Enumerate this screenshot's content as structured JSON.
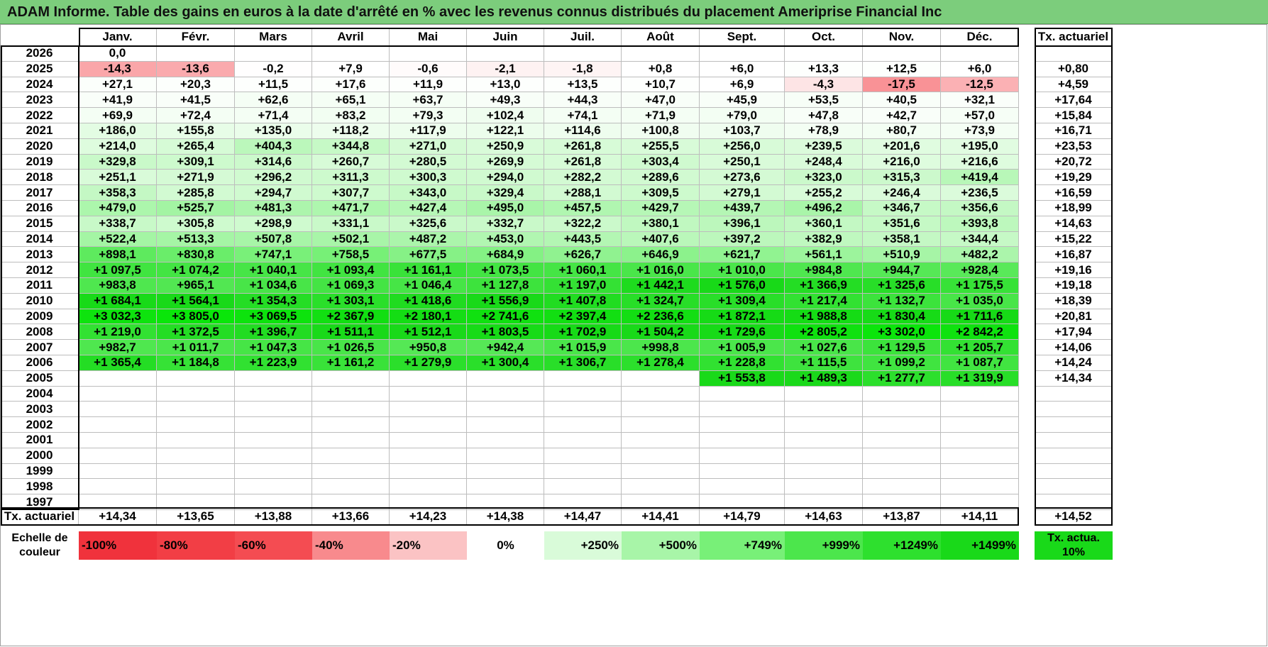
{
  "title": "ADAM Informe. Table des gains en euros à la date d'arrêté en % avec les revenus connus distribués du placement Ameriprise Financial Inc",
  "chart_data": {
    "type": "table",
    "months": [
      "Janv.",
      "Févr.",
      "Mars",
      "Avril",
      "Mai",
      "Juin",
      "Juil.",
      "Août",
      "Sept.",
      "Oct.",
      "Nov.",
      "Déc."
    ],
    "annual_header": "Tx. actuariel",
    "rows": [
      {
        "year": "2026",
        "values": [
          "0,0",
          "",
          "",
          "",
          "",
          "",
          "",
          "",
          "",
          "",
          "",
          ""
        ],
        "rate": ""
      },
      {
        "year": "2025",
        "values": [
          "-14,3",
          "-13,6",
          "-0,2",
          "+7,9",
          "-0,6",
          "-2,1",
          "-1,8",
          "+0,8",
          "+6,0",
          "+13,3",
          "+12,5",
          "+6,0"
        ],
        "rate": "+0,80"
      },
      {
        "year": "2024",
        "values": [
          "+27,1",
          "+20,3",
          "+11,5",
          "+17,6",
          "+11,9",
          "+13,0",
          "+13,5",
          "+10,7",
          "+6,9",
          "-4,3",
          "-17,5",
          "-12,5"
        ],
        "rate": "+4,59"
      },
      {
        "year": "2023",
        "values": [
          "+41,9",
          "+41,5",
          "+62,6",
          "+65,1",
          "+63,7",
          "+49,3",
          "+44,3",
          "+47,0",
          "+45,9",
          "+53,5",
          "+40,5",
          "+32,1"
        ],
        "rate": "+17,64"
      },
      {
        "year": "2022",
        "values": [
          "+69,9",
          "+72,4",
          "+71,4",
          "+83,2",
          "+79,3",
          "+102,4",
          "+74,1",
          "+71,9",
          "+79,0",
          "+47,8",
          "+42,7",
          "+57,0"
        ],
        "rate": "+15,84"
      },
      {
        "year": "2021",
        "values": [
          "+186,0",
          "+155,8",
          "+135,0",
          "+118,2",
          "+117,9",
          "+122,1",
          "+114,6",
          "+100,8",
          "+103,7",
          "+78,9",
          "+80,7",
          "+73,9"
        ],
        "rate": "+16,71"
      },
      {
        "year": "2020",
        "values": [
          "+214,0",
          "+265,4",
          "+404,3",
          "+344,8",
          "+271,0",
          "+250,9",
          "+261,8",
          "+255,5",
          "+256,0",
          "+239,5",
          "+201,6",
          "+195,0"
        ],
        "rate": "+23,53"
      },
      {
        "year": "2019",
        "values": [
          "+329,8",
          "+309,1",
          "+314,6",
          "+260,7",
          "+280,5",
          "+269,9",
          "+261,8",
          "+303,4",
          "+250,1",
          "+248,4",
          "+216,0",
          "+216,6"
        ],
        "rate": "+20,72"
      },
      {
        "year": "2018",
        "values": [
          "+251,1",
          "+271,9",
          "+296,2",
          "+311,3",
          "+300,3",
          "+294,0",
          "+282,2",
          "+289,6",
          "+273,6",
          "+323,0",
          "+315,3",
          "+419,4"
        ],
        "rate": "+19,29"
      },
      {
        "year": "2017",
        "values": [
          "+358,3",
          "+285,8",
          "+294,7",
          "+307,7",
          "+343,0",
          "+329,4",
          "+288,1",
          "+309,5",
          "+279,1",
          "+255,2",
          "+246,4",
          "+236,5"
        ],
        "rate": "+16,59"
      },
      {
        "year": "2016",
        "values": [
          "+479,0",
          "+525,7",
          "+481,3",
          "+471,7",
          "+427,4",
          "+495,0",
          "+457,5",
          "+429,7",
          "+439,7",
          "+496,2",
          "+346,7",
          "+356,6"
        ],
        "rate": "+18,99"
      },
      {
        "year": "2015",
        "values": [
          "+338,7",
          "+305,8",
          "+298,9",
          "+331,1",
          "+325,6",
          "+332,7",
          "+322,2",
          "+380,1",
          "+396,1",
          "+360,1",
          "+351,6",
          "+393,8"
        ],
        "rate": "+14,63"
      },
      {
        "year": "2014",
        "values": [
          "+522,4",
          "+513,3",
          "+507,8",
          "+502,1",
          "+487,2",
          "+453,0",
          "+443,5",
          "+407,6",
          "+397,2",
          "+382,9",
          "+358,1",
          "+344,4"
        ],
        "rate": "+15,22"
      },
      {
        "year": "2013",
        "values": [
          "+898,1",
          "+830,8",
          "+747,1",
          "+758,5",
          "+677,5",
          "+684,9",
          "+626,7",
          "+646,9",
          "+621,7",
          "+561,1",
          "+510,9",
          "+482,2"
        ],
        "rate": "+16,87"
      },
      {
        "year": "2012",
        "values": [
          "+1 097,5",
          "+1 074,2",
          "+1 040,1",
          "+1 093,4",
          "+1 161,1",
          "+1 073,5",
          "+1 060,1",
          "+1 016,0",
          "+1 010,0",
          "+984,8",
          "+944,7",
          "+928,4"
        ],
        "rate": "+19,16"
      },
      {
        "year": "2011",
        "values": [
          "+983,8",
          "+965,1",
          "+1 034,6",
          "+1 069,3",
          "+1 046,4",
          "+1 127,8",
          "+1 197,0",
          "+1 442,1",
          "+1 576,0",
          "+1 366,9",
          "+1 325,6",
          "+1 175,5"
        ],
        "rate": "+19,18"
      },
      {
        "year": "2010",
        "values": [
          "+1 684,1",
          "+1 564,1",
          "+1 354,3",
          "+1 303,1",
          "+1 418,6",
          "+1 556,9",
          "+1 407,8",
          "+1 324,7",
          "+1 309,4",
          "+1 217,4",
          "+1 132,7",
          "+1 035,0"
        ],
        "rate": "+18,39"
      },
      {
        "year": "2009",
        "values": [
          "+3 032,3",
          "+3 805,0",
          "+3 069,5",
          "+2 367,9",
          "+2 180,1",
          "+2 741,6",
          "+2 397,4",
          "+2 236,6",
          "+1 872,1",
          "+1 988,8",
          "+1 830,4",
          "+1 711,6"
        ],
        "rate": "+20,81"
      },
      {
        "year": "2008",
        "values": [
          "+1 219,0",
          "+1 372,5",
          "+1 396,7",
          "+1 511,1",
          "+1 512,1",
          "+1 803,5",
          "+1 702,9",
          "+1 504,2",
          "+1 729,6",
          "+2 805,2",
          "+3 302,0",
          "+2 842,2"
        ],
        "rate": "+17,94"
      },
      {
        "year": "2007",
        "values": [
          "+982,7",
          "+1 011,7",
          "+1 047,3",
          "+1 026,5",
          "+950,8",
          "+942,4",
          "+1 015,9",
          "+998,8",
          "+1 005,9",
          "+1 027,6",
          "+1 129,5",
          "+1 205,7"
        ],
        "rate": "+14,06"
      },
      {
        "year": "2006",
        "values": [
          "+1 365,4",
          "+1 184,8",
          "+1 223,9",
          "+1 161,2",
          "+1 279,9",
          "+1 300,4",
          "+1 306,7",
          "+1 278,4",
          "+1 228,8",
          "+1 115,5",
          "+1 099,2",
          "+1 087,7"
        ],
        "rate": "+14,24"
      },
      {
        "year": "2005",
        "values": [
          "",
          "",
          "",
          "",
          "",
          "",
          "",
          "",
          "+1 553,8",
          "+1 489,3",
          "+1 277,7",
          "+1 319,9"
        ],
        "rate": "+14,34"
      },
      {
        "year": "2004",
        "values": [
          "",
          "",
          "",
          "",
          "",
          "",
          "",
          "",
          "",
          "",
          "",
          ""
        ],
        "rate": ""
      },
      {
        "year": "2003",
        "values": [
          "",
          "",
          "",
          "",
          "",
          "",
          "",
          "",
          "",
          "",
          "",
          ""
        ],
        "rate": ""
      },
      {
        "year": "2002",
        "values": [
          "",
          "",
          "",
          "",
          "",
          "",
          "",
          "",
          "",
          "",
          "",
          ""
        ],
        "rate": ""
      },
      {
        "year": "2001",
        "values": [
          "",
          "",
          "",
          "",
          "",
          "",
          "",
          "",
          "",
          "",
          "",
          ""
        ],
        "rate": ""
      },
      {
        "year": "2000",
        "values": [
          "",
          "",
          "",
          "",
          "",
          "",
          "",
          "",
          "",
          "",
          "",
          ""
        ],
        "rate": ""
      },
      {
        "year": "1999",
        "values": [
          "",
          "",
          "",
          "",
          "",
          "",
          "",
          "",
          "",
          "",
          "",
          ""
        ],
        "rate": ""
      },
      {
        "year": "1998",
        "values": [
          "",
          "",
          "",
          "",
          "",
          "",
          "",
          "",
          "",
          "",
          "",
          ""
        ],
        "rate": ""
      },
      {
        "year": "1997",
        "values": [
          "",
          "",
          "",
          "",
          "",
          "",
          "",
          "",
          "",
          "",
          "",
          ""
        ],
        "rate": ""
      }
    ],
    "summary_row": {
      "label": "Tx. actuariel",
      "values": [
        "+14,34",
        "+13,65",
        "+13,88",
        "+13,66",
        "+14,23",
        "+14,38",
        "+14,47",
        "+14,41",
        "+14,79",
        "+14,63",
        "+13,87",
        "+14,11"
      ],
      "overall": "+14,52"
    },
    "legend": {
      "label": "Echelle de couleur",
      "items": [
        {
          "text": "-100%",
          "color": "#f0323c",
          "align": "left"
        },
        {
          "text": "-80%",
          "color": "#f23e45",
          "align": "left"
        },
        {
          "text": "-60%",
          "color": "#f44c52",
          "align": "left"
        },
        {
          "text": "-40%",
          "color": "#f88a8d",
          "align": "left"
        },
        {
          "text": "-20%",
          "color": "#fbc3c4",
          "align": "left"
        },
        {
          "text": "0%",
          "color": "#ffffff",
          "align": "center"
        },
        {
          "text": "+250%",
          "color": "#d9fbd9",
          "align": "right"
        },
        {
          "text": "+500%",
          "color": "#a8f5a8",
          "align": "right"
        },
        {
          "text": "+749%",
          "color": "#78f078",
          "align": "right"
        },
        {
          "text": "+999%",
          "color": "#4ce64c",
          "align": "right"
        },
        {
          "text": "+1249%",
          "color": "#2ee02e",
          "align": "right"
        },
        {
          "text": "+1499%",
          "color": "#19d919",
          "align": "right"
        }
      ],
      "rate_item": {
        "text": "Tx. actua. 10%",
        "color": "#19d919"
      }
    }
  }
}
